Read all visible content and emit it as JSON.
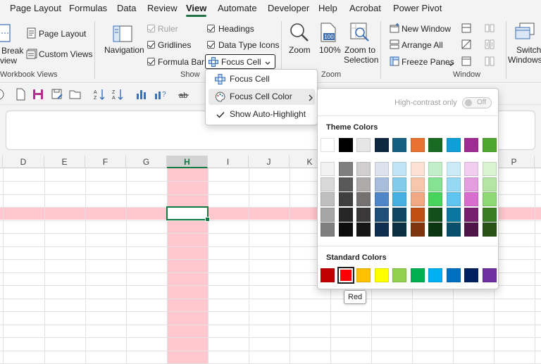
{
  "menu_tabs": [
    {
      "label": "Page Layout"
    },
    {
      "label": "Formulas"
    },
    {
      "label": "Data"
    },
    {
      "label": "Review"
    },
    {
      "label": "View"
    },
    {
      "label": "Automate"
    },
    {
      "label": "Developer"
    },
    {
      "label": "Help"
    },
    {
      "label": "Acrobat"
    },
    {
      "label": "Power Pivot"
    }
  ],
  "active_tab": "View",
  "ribbon": {
    "workbook_views": {
      "label": "Workbook Views",
      "page_break_preview": [
        "Break",
        "view"
      ],
      "page_layout": "Page Layout",
      "custom_views": "Custom Views"
    },
    "show": {
      "label": "Show",
      "navigation": "Navigation",
      "ruler": "Ruler",
      "ruler_checked": true,
      "ruler_enabled": false,
      "gridlines": "Gridlines",
      "gridlines_checked": true,
      "formula_bar": "Formula Bar",
      "formula_bar_checked": true,
      "headings": "Headings",
      "headings_checked": true,
      "data_type_icons": "Data Type Icons",
      "data_type_icons_checked": true,
      "focus_cell": "Focus Cell"
    },
    "zoom": {
      "label": "Zoom",
      "zoom": "Zoom",
      "zoom_100": "100%",
      "zoom_to_selection": [
        "Zoom to",
        "Selection"
      ]
    },
    "window": {
      "label": "Window",
      "new_window": "New Window",
      "arrange_all": "Arrange All",
      "freeze_panes": "Freeze Panes",
      "switch_windows": [
        "Switch",
        "Windows"
      ]
    }
  },
  "columns": [
    "D",
    "E",
    "F",
    "G",
    "H",
    "I",
    "J",
    "K",
    "P"
  ],
  "selected_column": "H",
  "focus_cell_menu": {
    "items": [
      {
        "label": "Focus Cell",
        "icon": "focus-cell-icon"
      },
      {
        "label": "Focus Cell Color",
        "icon": "palette-icon",
        "submenu": true
      },
      {
        "label": "Show Auto-Highlight",
        "icon": "checkmark-icon",
        "checked": true
      }
    ]
  },
  "color_picker": {
    "high_contrast_label": "High-contrast only",
    "high_contrast_state": "Off",
    "theme_colors_label": "Theme Colors",
    "standard_colors_label": "Standard Colors",
    "theme_top": [
      "#ffffff",
      "#000000",
      "#e7e6e6",
      "#0e2841",
      "#156082",
      "#e97132",
      "#196b24",
      "#0f9ed5",
      "#a02b93",
      "#4ea72e"
    ],
    "theme_shades": [
      [
        "#f2f2f2",
        "#7f7f7f",
        "#d0cece",
        "#dce3ee",
        "#c1e4f5",
        "#fbe2d5",
        "#c1f0c8",
        "#cbebf9",
        "#f1cdef",
        "#d9f3d0"
      ],
      [
        "#d9d9d9",
        "#595959",
        "#aeaaaa",
        "#a7bddb",
        "#83cbeb",
        "#f6c6ad",
        "#84e291",
        "#97d9f5",
        "#e49edf",
        "#b4e5a2"
      ],
      [
        "#bfbfbf",
        "#3f3f3f",
        "#757171",
        "#4e86c8",
        "#45b0e1",
        "#f1a983",
        "#48d45c",
        "#5fc5f0",
        "#d86dcd",
        "#8ed973"
      ],
      [
        "#a6a6a6",
        "#262626",
        "#3a3838",
        "#1f4e78",
        "#0f4761",
        "#c04f15",
        "#124f1a",
        "#0b76a0",
        "#77206d",
        "#3b7d23"
      ],
      [
        "#7f7f7f",
        "#0d0d0d",
        "#171616",
        "#102e4f",
        "#0a3041",
        "#7f350e",
        "#0c3512",
        "#074f6a",
        "#4f1548",
        "#275317"
      ]
    ],
    "standard": [
      "#c00000",
      "#ff0000",
      "#ffc000",
      "#ffff00",
      "#92d050",
      "#00b050",
      "#00b0f0",
      "#0070c0",
      "#002060",
      "#7030a0"
    ],
    "selected_standard_index": 1,
    "tooltip": "Red"
  },
  "highlight_color": "#ffc7ce",
  "accent_color": "#107c41"
}
